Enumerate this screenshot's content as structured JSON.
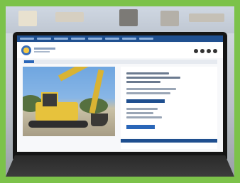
{
  "scene": {
    "subject": "laptop",
    "laptop_brand_label": "",
    "website_listing": "excavator"
  },
  "colors": {
    "border": "#7cc24a",
    "site_nav": "#1f4f8f",
    "accent": "#2a66b8",
    "machine": "#e7c23c"
  }
}
